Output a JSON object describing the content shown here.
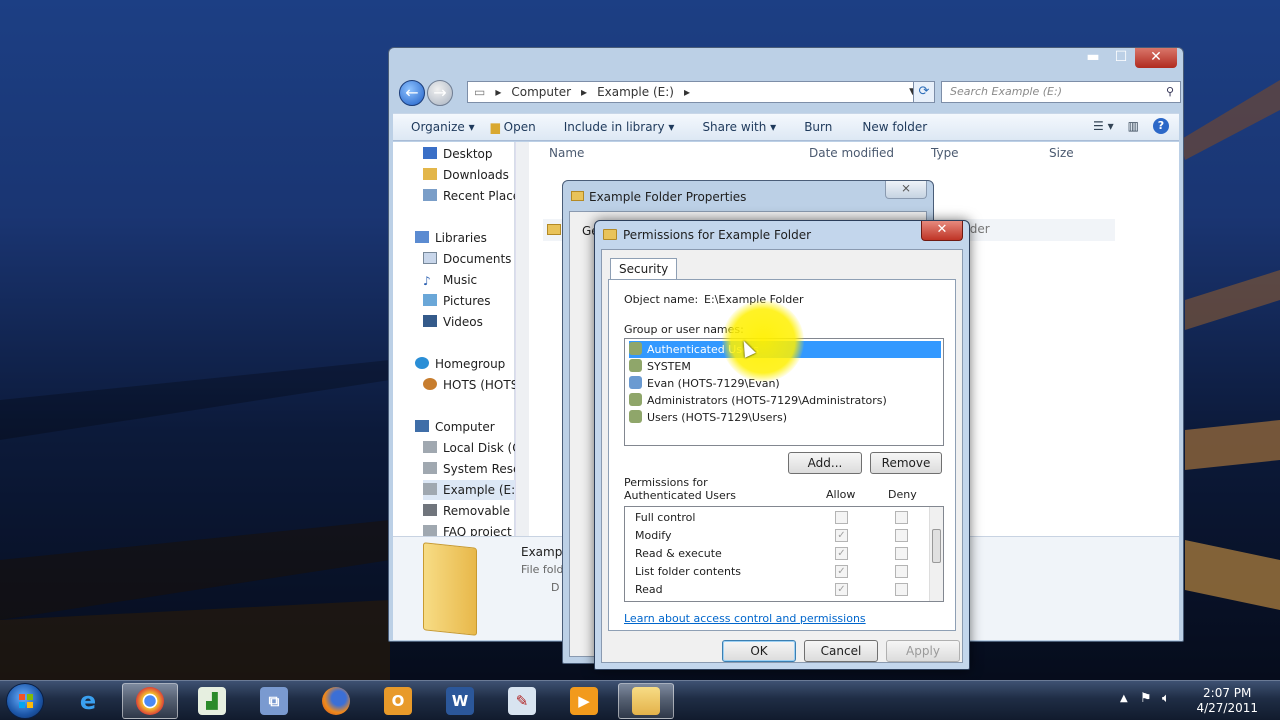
{
  "explorer": {
    "breadcrumb": [
      "Computer",
      "Example (E:)"
    ],
    "search_placeholder": "Search Example (E:)",
    "toolbar": {
      "organize": "Organize",
      "open": "Open",
      "include_in_library": "Include in library",
      "share_with": "Share with",
      "burn": "Burn",
      "new_folder": "New folder"
    },
    "nav": {
      "favorites": [
        "Desktop",
        "Downloads",
        "Recent Places"
      ],
      "libraries": "Libraries",
      "library_items": [
        "Documents",
        "Music",
        "Pictures",
        "Videos"
      ],
      "homegroup": "Homegroup",
      "homegroup_items": [
        "HOTS (HOTS"
      ],
      "computer": "Computer",
      "computer_items": [
        "Local Disk (C:)",
        "System Reserved",
        "Example (E:)",
        "Removable Disk",
        "FAQ project"
      ]
    },
    "columns": {
      "name": "Name",
      "date_modified": "Date modified",
      "type": "Type",
      "size": "Size"
    },
    "file_row": {
      "type": "File folder"
    },
    "details": {
      "name": "Examp",
      "type": "File fold",
      "date_prefix": "D"
    }
  },
  "properties": {
    "title": "Example Folder Properties",
    "close": "⨯",
    "tab_stub": "Ge"
  },
  "permissions": {
    "title": "Permissions for Example Folder",
    "close": "✕",
    "tab": "Security",
    "object_name_label": "Object name:",
    "object_name_value": "E:\\Example Folder",
    "group_label": "Group or user names:",
    "users": [
      "Authenticated Users",
      "SYSTEM",
      "Evan (HOTS-7129\\Evan)",
      "Administrators (HOTS-7129\\Administrators)",
      "Users (HOTS-7129\\Users)"
    ],
    "add": "Add...",
    "remove": "Remove",
    "perm_label": "Permissions for Authenticated Users",
    "allow": "Allow",
    "deny": "Deny",
    "perm_items": [
      "Full control",
      "Modify",
      "Read & execute",
      "List folder contents",
      "Read"
    ],
    "link": "Learn about access control and permissions",
    "ok": "OK",
    "cancel": "Cancel",
    "apply": "Apply"
  },
  "taskbar": {
    "time": "2:07 PM",
    "date": "4/27/2011"
  }
}
